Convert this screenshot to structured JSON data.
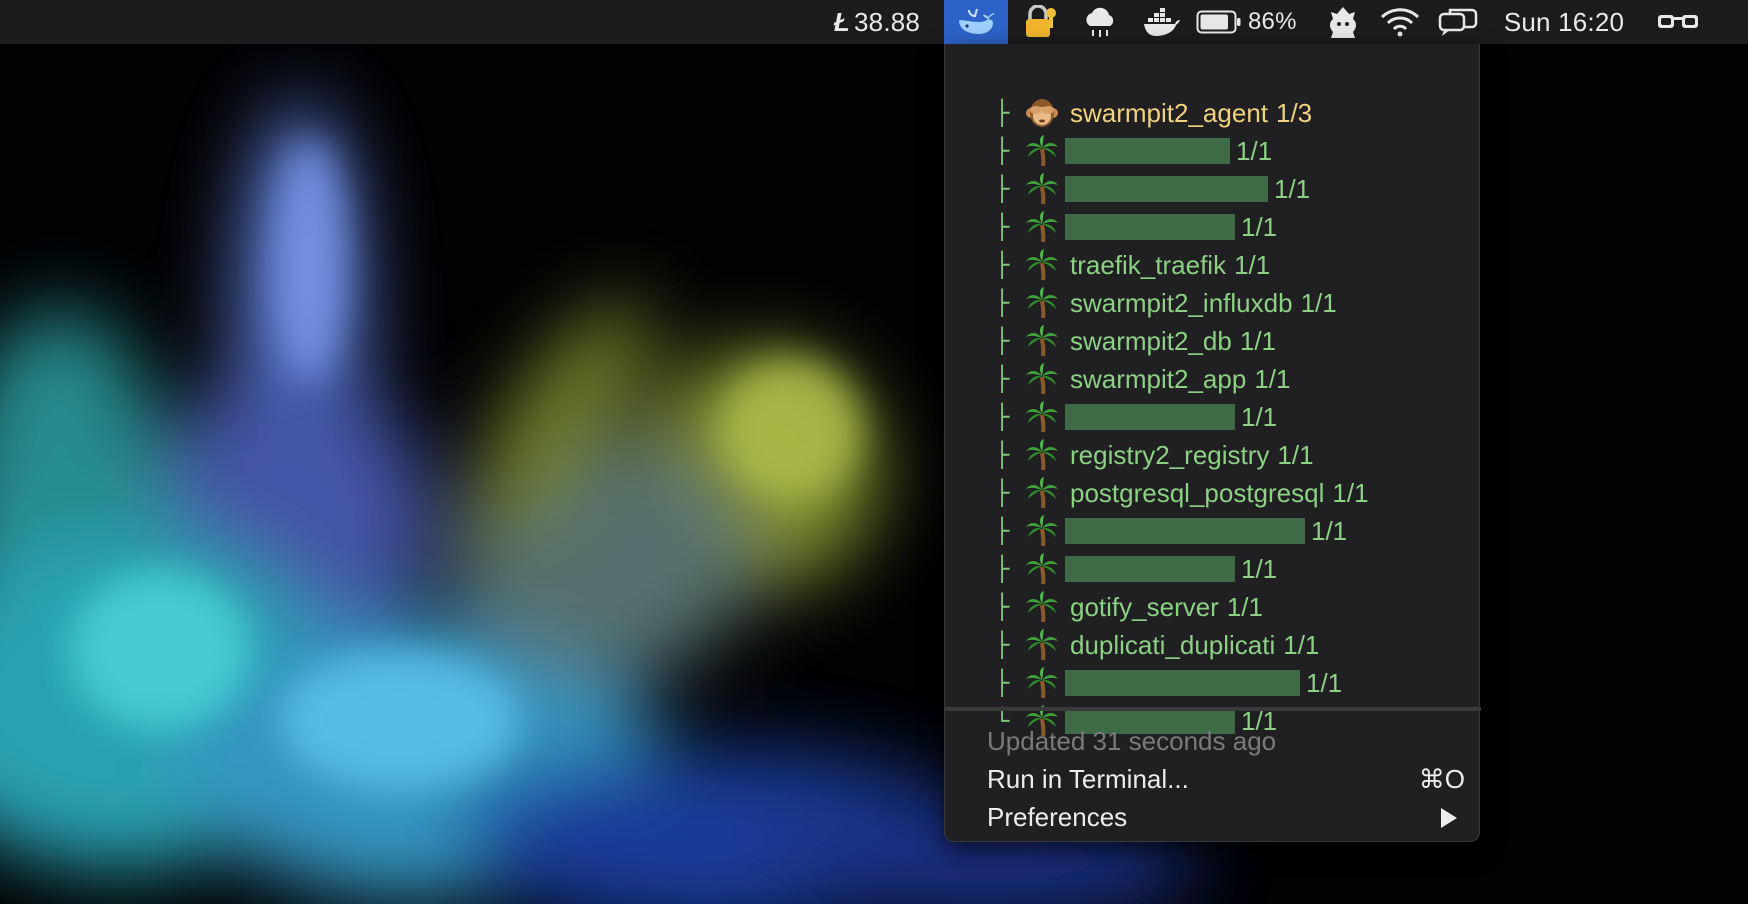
{
  "menubar": {
    "ltc_symbol": "Ł",
    "ltc_price": "38.88",
    "battery_percent": "86%",
    "battery_level": 0.86,
    "clock": "Sun 16:20",
    "icons": [
      "whale-icon",
      "lock-key-icon",
      "cloud-icon",
      "docker-icon",
      "battery-icon",
      "user-bot-icon",
      "wifi-icon",
      "bubbles-icon",
      "glasses-icon"
    ]
  },
  "dropdown": {
    "services": [
      {
        "name": "swarmpit2_agent",
        "count": "1/3",
        "status": "warning",
        "icon": "monkey-icon"
      },
      {
        "name": "",
        "count": "1/1",
        "status": "ok",
        "icon": "palm-tree-icon"
      },
      {
        "name": "",
        "count": "1/1",
        "status": "ok",
        "icon": "palm-tree-icon"
      },
      {
        "name": "",
        "count": "1/1",
        "status": "ok",
        "icon": "palm-tree-icon"
      },
      {
        "name": "traefik_traefik",
        "count": "1/1",
        "status": "ok",
        "icon": "palm-tree-icon"
      },
      {
        "name": "swarmpit2_influxdb",
        "count": "1/1",
        "status": "ok",
        "icon": "palm-tree-icon"
      },
      {
        "name": "swarmpit2_db",
        "count": "1/1",
        "status": "ok",
        "icon": "palm-tree-icon"
      },
      {
        "name": "swarmpit2_app",
        "count": "1/1",
        "status": "ok",
        "icon": "palm-tree-icon"
      },
      {
        "name": "",
        "count": "1/1",
        "status": "ok",
        "icon": "palm-tree-icon"
      },
      {
        "name": "registry2_registry",
        "count": "1/1",
        "status": "ok",
        "icon": "palm-tree-icon"
      },
      {
        "name": "postgresql_postgresql",
        "count": "1/1",
        "status": "ok",
        "icon": "palm-tree-icon"
      },
      {
        "name": "",
        "count": "1/1",
        "status": "ok",
        "icon": "palm-tree-icon"
      },
      {
        "name": "",
        "count": "1/1",
        "status": "ok",
        "icon": "palm-tree-icon"
      },
      {
        "name": "gotify_server",
        "count": "1/1",
        "status": "ok",
        "icon": "palm-tree-icon"
      },
      {
        "name": "duplicati_duplicati",
        "count": "1/1",
        "status": "ok",
        "icon": "palm-tree-icon"
      },
      {
        "name": "",
        "count": "1/1",
        "status": "ok",
        "icon": "palm-tree-icon"
      },
      {
        "name": "",
        "count": "1/1",
        "status": "ok",
        "icon": "palm-tree-icon"
      }
    ],
    "tree_branch": "├",
    "tree_last": "└",
    "updated_text": "Updated 31 seconds ago",
    "run_in_terminal": "Run in Terminal...",
    "run_shortcut": "⌘O",
    "preferences": "Preferences"
  },
  "colors": {
    "ok_text": "#8bd083",
    "warning_text": "#f0d27e",
    "menubar_bg": "#1c1c1e",
    "dropdown_bg": "#202022",
    "active_icon_bg": "#2d63c8"
  }
}
